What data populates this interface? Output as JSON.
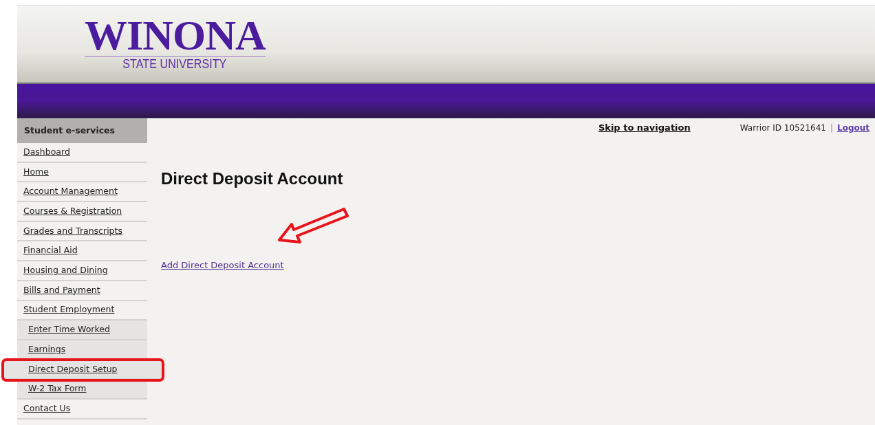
{
  "logo": {
    "name": "WINONA",
    "subtitle": "STATE UNIVERSITY"
  },
  "sidebar": {
    "title": "Student e-services",
    "items": [
      {
        "label": "Dashboard",
        "highlighted": false
      },
      {
        "label": "Home",
        "highlighted": false
      },
      {
        "label": "Account Management",
        "highlighted": false
      },
      {
        "label": "Courses & Registration",
        "highlighted": false
      },
      {
        "label": "Grades and Transcripts",
        "highlighted": false
      },
      {
        "label": "Financial Aid",
        "highlighted": false
      },
      {
        "label": "Housing and Dining",
        "highlighted": false
      },
      {
        "label": "Bills and Payment",
        "highlighted": false
      },
      {
        "label": "Student Employment",
        "highlighted": false,
        "children": [
          {
            "label": "Enter Time Worked",
            "highlighted": false
          },
          {
            "label": "Earnings",
            "highlighted": false
          },
          {
            "label": "Direct Deposit Setup",
            "highlighted": true
          },
          {
            "label": "W-2 Tax Form",
            "highlighted": false
          }
        ]
      },
      {
        "label": "Contact Us",
        "highlighted": false
      }
    ]
  },
  "topbar": {
    "skip_link": "Skip to navigation",
    "user_id": "Warrior ID 10521641",
    "separator": "|",
    "logout": "Logout"
  },
  "page": {
    "title": "Direct Deposit Account",
    "link": "Add Direct Deposit Account"
  }
}
